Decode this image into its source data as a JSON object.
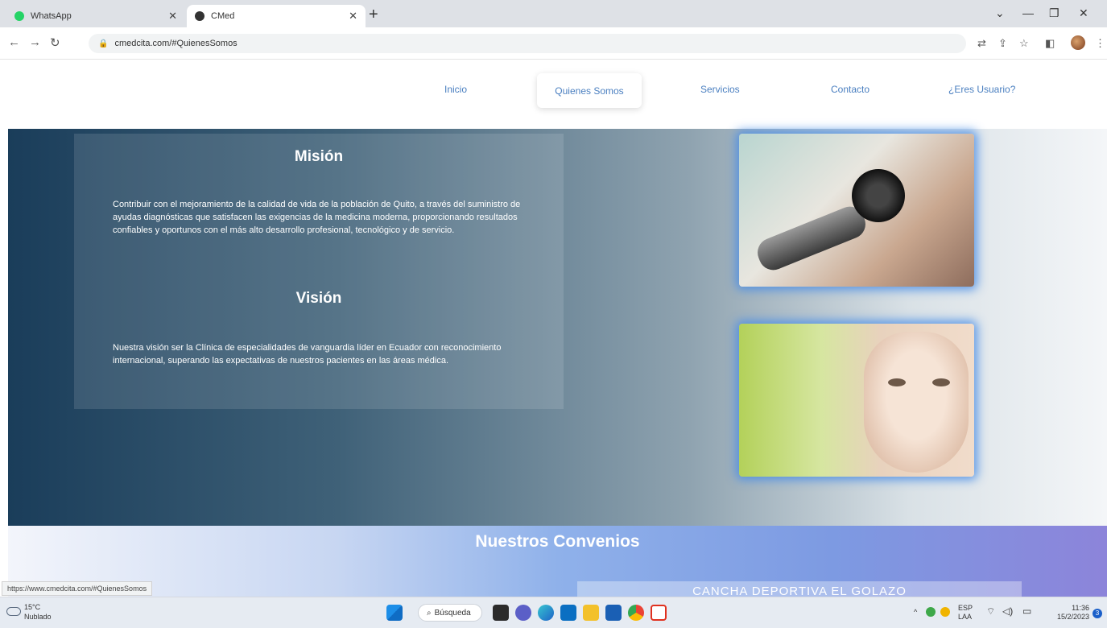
{
  "browser": {
    "tabs": [
      {
        "label": "WhatsApp",
        "active": false,
        "favicon_color": "#25d366"
      },
      {
        "label": "CMed",
        "active": true,
        "favicon_color": "#333333"
      }
    ],
    "new_tab_glyph": "+",
    "url": "cmedcita.com/#QuienesSomos",
    "status_url": "https://www.cmedcita.com/#QuienesSomos"
  },
  "nav": {
    "items": [
      {
        "label": "Inicio"
      },
      {
        "label": "Quienes Somos",
        "active": true
      },
      {
        "label": "Servicios"
      },
      {
        "label": "Contacto"
      },
      {
        "label": "¿Eres Usuario?"
      }
    ]
  },
  "mission": {
    "title": "Misión",
    "text": "Contribuir con el mejoramiento de la calidad de vida de la población de Quito, a través del suministro de ayudas diagnósticas que satisfacen las exigencias de la medicina moderna, proporcionando resultados confiables y oportunos con el más alto desarrollo profesional, tecnológico y de servicio."
  },
  "vision": {
    "title": "Visión",
    "text": "Nuestra visión ser la Clínica de especialidades de vanguardia líder en Ecuador con reconocimiento internacional, superando las expectativas de nuestros pacientes en las áreas médica."
  },
  "convenios": {
    "title": "Nuestros Convenios",
    "card_text": "CANCHA DEPORTIVA EL GOLAZO"
  },
  "taskbar": {
    "weather_temp": "15°C",
    "weather_desc": "Nublado",
    "search_label": "Búsqueda",
    "lang_top": "ESP",
    "lang_bottom": "LAA",
    "time": "11:36",
    "date": "15/2/2023",
    "notification_count": "3"
  },
  "colors": {
    "accent": "#4a7fc0",
    "hero_dark": "#1a3d5a",
    "photo_glow": "#468ce6"
  }
}
